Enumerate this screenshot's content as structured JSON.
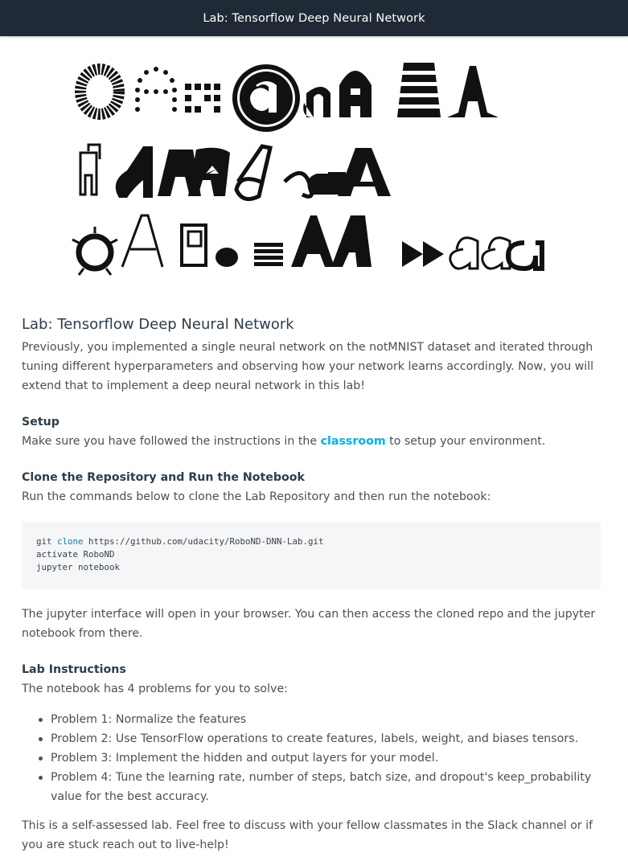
{
  "header": {
    "title": "Lab: Tensorflow Deep Neural Network"
  },
  "hero": {
    "icon": "notmnist-letters-image",
    "rows": 3,
    "description_hidden": true
  },
  "article": {
    "title": "Lab: Tensorflow Deep Neural Network",
    "intro": "Previously, you implemented a single neural network on the notMNIST dataset and iterated through tuning different hyperparameters and observing how your network learns accordingly. Now, you will extend that to implement a deep neural network in this lab!",
    "setup": {
      "heading": "Setup",
      "text_before": "Make sure you have followed the instructions in the ",
      "link_text": "classroom",
      "text_after": " to setup your environment."
    },
    "clone": {
      "heading": "Clone the Repository and Run the Notebook",
      "text": "Run the commands below to clone the Lab Repository and then run the notebook:",
      "code": {
        "line1_cmd": "git ",
        "line1_kw": "clone",
        "line1_rest": " https://github.com/udacity/RoboND-DNN-Lab.git",
        "line2": "activate RoboND",
        "line3": "jupyter notebook"
      },
      "after": "The jupyter interface will open in your browser. You can then access the cloned repo and the jupyter notebook from there."
    },
    "instructions": {
      "heading": "Lab Instructions",
      "text": "The notebook has 4 problems for you to solve:",
      "problems": [
        "Problem 1: Normalize the features",
        "Problem 2: Use TensorFlow operations to create features, labels, weight, and biases tensors.",
        "Problem 3: Implement the hidden and output layers for your model.",
        "Problem 4: Tune the learning rate, number of steps, batch size, and dropout's keep_probability value for the best accuracy."
      ],
      "closing": "This is a self-assessed lab. Feel free to discuss with your fellow classmates in the Slack channel or if you are stuck reach out to live-help!"
    }
  },
  "colors": {
    "header_bg": "#1f2a36",
    "link": "#02b3e4",
    "code_bg": "#f5f6f7"
  }
}
